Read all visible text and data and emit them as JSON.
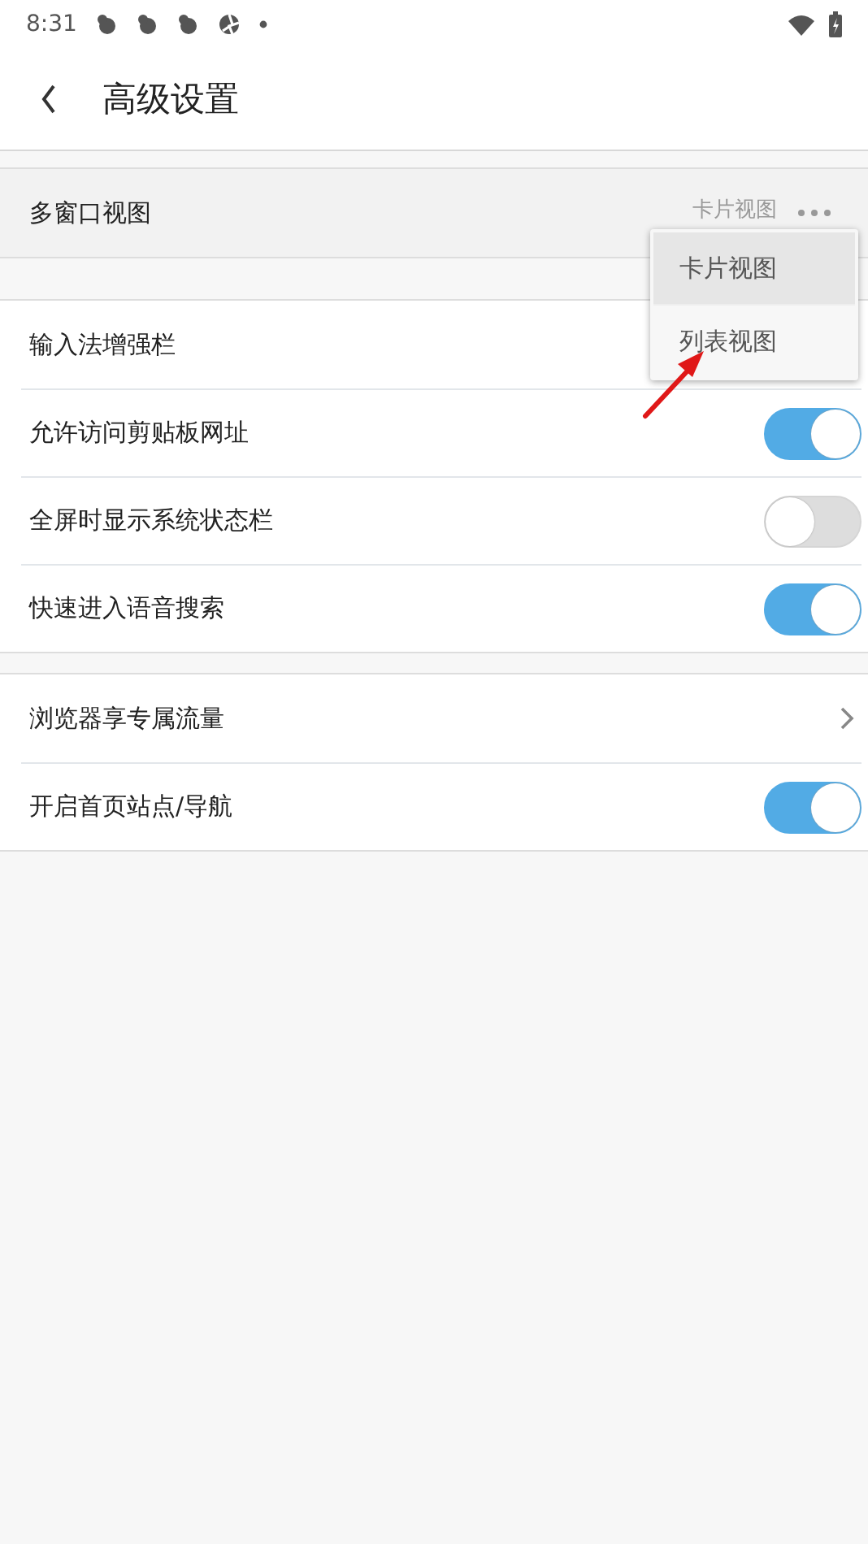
{
  "status_bar": {
    "time": "8:31"
  },
  "header": {
    "title": "高级设置"
  },
  "sections": [
    {
      "kind": "highlight",
      "rows": [
        {
          "kind": "value",
          "label": "多窗口视图",
          "value": "卡片视图"
        }
      ]
    },
    {
      "kind": "plain",
      "rows": [
        {
          "kind": "none",
          "label": "输入法增强栏"
        },
        {
          "kind": "toggle",
          "label": "允许访问剪贴板网址",
          "on": true
        },
        {
          "kind": "toggle",
          "label": "全屏时显示系统状态栏",
          "on": false
        },
        {
          "kind": "toggle",
          "label": "快速进入语音搜索",
          "on": true
        }
      ]
    },
    {
      "kind": "plain",
      "rows": [
        {
          "kind": "chevron",
          "label": "浏览器享专属流量"
        },
        {
          "kind": "toggle",
          "label": "开启首页站点/导航",
          "on": true
        }
      ]
    }
  ],
  "popup_menu": {
    "items": [
      {
        "label": "卡片视图",
        "selected": true
      },
      {
        "label": "列表视图",
        "selected": false
      }
    ]
  }
}
